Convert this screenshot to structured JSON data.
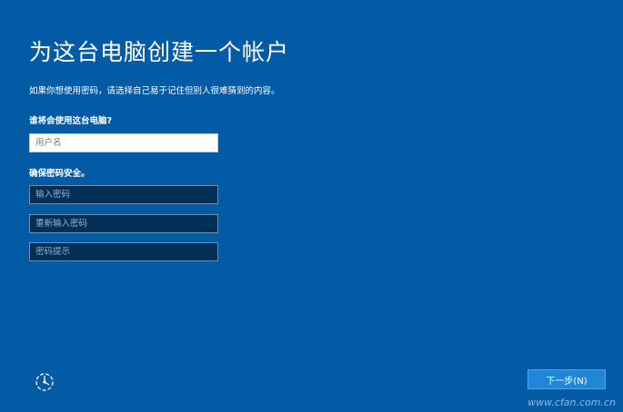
{
  "header": {
    "title": "为这台电脑创建一个帐户",
    "intro": "如果你想使用密码，请选择自己易于记住但别人很难猜到的内容。"
  },
  "user_section": {
    "label": "谁将会使用这台电脑?",
    "username": {
      "value": "",
      "placeholder": "用户名"
    }
  },
  "password_section": {
    "label": "确保密码安全。",
    "password": {
      "value": "",
      "placeholder": "输入密码"
    },
    "confirm_password": {
      "value": "",
      "placeholder": "重新输入密码"
    },
    "hint": {
      "value": "",
      "placeholder": "密码提示"
    }
  },
  "footer": {
    "accessibility_icon": "ease-of-access-icon",
    "next_label": "下一步(N)"
  },
  "watermark": "www.cfan.com.cn",
  "colors": {
    "background": "#035ba6",
    "button": "#1f86d8",
    "dark_field": "#022f56"
  }
}
